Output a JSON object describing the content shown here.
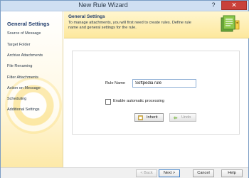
{
  "window": {
    "title": "New Rule Wizard",
    "help_label": "?",
    "close_label": "✕"
  },
  "sidebar": {
    "heading": "General Settings",
    "items": [
      {
        "label": "Source of Message"
      },
      {
        "label": "Target Folder"
      },
      {
        "label": "Archive Attachments"
      },
      {
        "label": "File Renaming"
      },
      {
        "label": "Filter Attachments"
      },
      {
        "label": "Action on Message"
      },
      {
        "label": "Scheduling"
      },
      {
        "label": "Additional Settings"
      }
    ]
  },
  "header": {
    "title": "General Settings",
    "description": "To manage attachments, you will first need to create rules. Define rule name and general settings for the rule.",
    "icon": "rule-wizard-icon"
  },
  "form": {
    "rule_name_label": "Rule Name",
    "rule_name_value": "Softpedia rule",
    "auto_processing_label": "Enable automatic processing",
    "auto_processing_checked": false,
    "inherit_label": "Inherit",
    "undo_label": "Undo"
  },
  "footer": {
    "back_label": "< Back",
    "next_label": "Next >",
    "cancel_label": "Cancel",
    "help_label": "Help"
  },
  "colors": {
    "accent": "#3c7fc9",
    "header_bg": "#fde89d",
    "close": "#c9413a"
  }
}
